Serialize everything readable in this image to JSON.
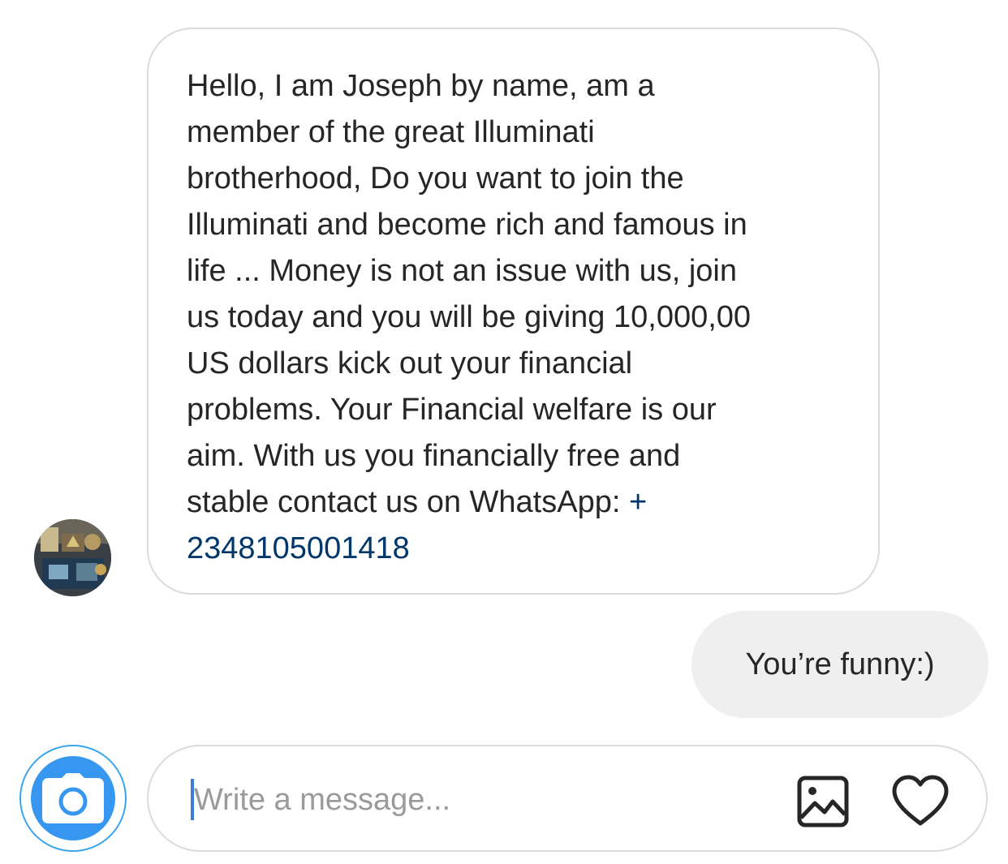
{
  "thread": {
    "incoming": {
      "avatar_icon": "profile-photo-icon",
      "text": "Hello, I am Joseph by name, am a\nmember of the great Illuminati\nbrotherhood, Do you want to join the\nIlluminati and become rich and famous in\nlife ... Money is not an issue with us, join\nus today and you will be giving 10,000,00\nUS dollars kick out your financial\nproblems. Your Financial welfare is our\naim. With us you financially free and\nstable contact us on WhatsApp: ",
      "phone_link": "+\n2348105001418"
    },
    "outgoing": {
      "text": "You’re funny:)"
    }
  },
  "composer": {
    "placeholder": "Write a message...",
    "value": "",
    "camera_icon": "camera-icon",
    "gallery_icon": "image-icon",
    "like_icon": "heart-icon"
  },
  "colors": {
    "accent": "#3797f0",
    "link": "#00376b",
    "bubble_border": "#dbdbdb",
    "outgoing_bubble": "#efefef"
  }
}
